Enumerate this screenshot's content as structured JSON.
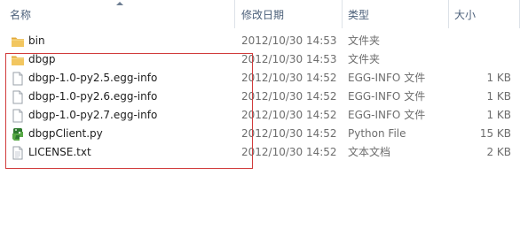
{
  "columns": {
    "name": "名称",
    "date": "修改日期",
    "type": "类型",
    "size": "大小"
  },
  "files": [
    {
      "name": "bin",
      "date": "2012/10/30 14:53",
      "type": "文件夹",
      "size": "",
      "icon": "folder-icon"
    },
    {
      "name": "dbgp",
      "date": "2012/10/30 14:53",
      "type": "文件夹",
      "size": "",
      "icon": "folder-icon"
    },
    {
      "name": "dbgp-1.0-py2.5.egg-info",
      "date": "2012/10/30 14:52",
      "type": "EGG-INFO 文件",
      "size": "1 KB",
      "icon": "file-icon"
    },
    {
      "name": "dbgp-1.0-py2.6.egg-info",
      "date": "2012/10/30 14:52",
      "type": "EGG-INFO 文件",
      "size": "1 KB",
      "icon": "file-icon"
    },
    {
      "name": "dbgp-1.0-py2.7.egg-info",
      "date": "2012/10/30 14:52",
      "type": "EGG-INFO 文件",
      "size": "1 KB",
      "icon": "file-icon"
    },
    {
      "name": "dbgpClient.py",
      "date": "2012/10/30 14:52",
      "type": "Python File",
      "size": "15 KB",
      "icon": "python-file-icon"
    },
    {
      "name": "LICENSE.txt",
      "date": "2012/10/30 14:52",
      "type": "文本文档",
      "size": "2 KB",
      "icon": "text-file-icon"
    }
  ],
  "colors": {
    "header_text": "#4c607a",
    "highlight_border": "#d13b3b",
    "folder": "#e8b94a"
  }
}
